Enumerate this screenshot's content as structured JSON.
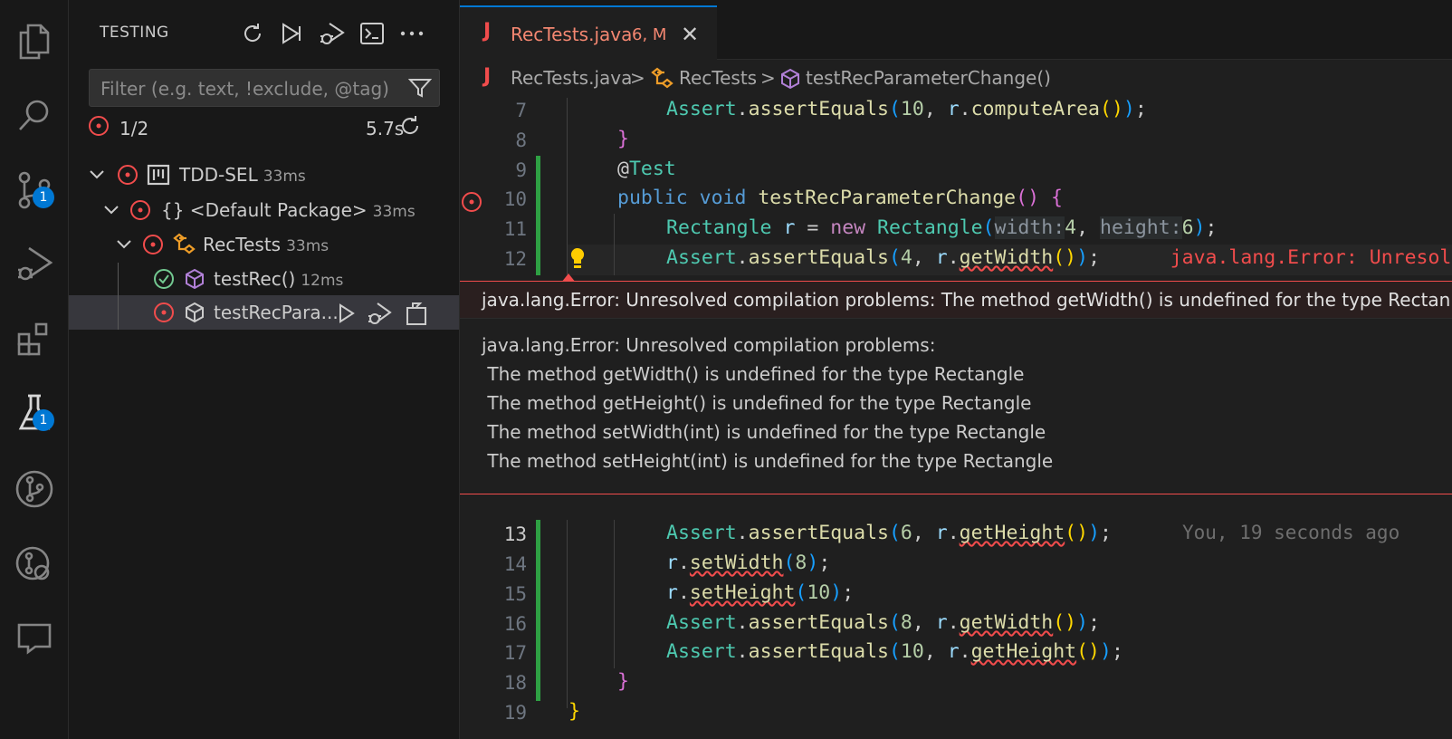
{
  "activity_bar": {
    "items": [
      {
        "name": "explorer-icon",
        "badge": ""
      },
      {
        "name": "search-icon",
        "badge": ""
      },
      {
        "name": "source-control-icon",
        "badge": "1"
      },
      {
        "name": "run-debug-icon",
        "badge": ""
      },
      {
        "name": "extensions-icon",
        "badge": ""
      },
      {
        "name": "testing-icon",
        "badge": "1"
      },
      {
        "name": "git-graph-icon",
        "badge": ""
      },
      {
        "name": "git-lens-icon",
        "badge": ""
      },
      {
        "name": "chat-icon",
        "badge": ""
      }
    ]
  },
  "sidebar": {
    "title": "TESTING",
    "filter_placeholder": "Filter (e.g. text, !exclude, @tag)",
    "summary": {
      "count": "1/2",
      "time": "5.7s"
    },
    "tree": [
      {
        "label": "TDD-SEL",
        "duration": "33ms",
        "status": "failed"
      },
      {
        "label": "{} <Default Package>",
        "duration": "33ms",
        "status": "failed"
      },
      {
        "label": "RecTests",
        "duration": "33ms",
        "status": "failed"
      },
      {
        "label": "testRec()",
        "duration": "12ms",
        "status": "passed"
      },
      {
        "label": "testRecPara...",
        "duration": "",
        "status": "failed"
      }
    ]
  },
  "editor": {
    "tab": {
      "icon": "J",
      "name": "RecTests.java",
      "status": "6, M"
    },
    "breadcrumb": [
      "RecTests.java",
      ">",
      "RecTests",
      ">",
      "testRecParameterChange()"
    ],
    "lines_top": [
      "7",
      "8",
      "9",
      "10",
      "11",
      "12"
    ],
    "lines_bottom": [
      "13",
      "14",
      "15",
      "16",
      "17",
      "18",
      "19"
    ],
    "code": {
      "l7": {
        "a": "Assert",
        "b": ".",
        "c": "assertEquals",
        "d": "(",
        "e": "10",
        "f": ", ",
        "g": "r",
        "h": ".",
        "i": "computeArea",
        "j": "()",
        "k": ")",
        "l": ";"
      },
      "l8": "}",
      "l9": {
        "at": "@",
        "t": "Test"
      },
      "l10": {
        "a": "public",
        "b": " ",
        "c": "void",
        "d": " ",
        "e": "testRecParameterChange",
        "f": "()",
        "g": " {"
      },
      "l11": {
        "a": "Rectangle",
        "b": " ",
        "c": "r",
        "d": " = ",
        "e": "new",
        "f": " ",
        "g": "Rectangle",
        "h": "(",
        "i": "width:",
        "j": "4",
        "k": ", ",
        "l": "height:",
        "m": "6",
        "n": ")",
        "o": ";"
      },
      "l12": {
        "a": "Assert",
        "b": ".",
        "c": "assertEquals",
        "d": "(",
        "e": "4",
        "f": ", ",
        "g": "r",
        "h": ".",
        "i": "getWidth",
        "j": "()",
        "k": ")",
        "l": ";",
        "err": "java.lang.Error: Unresol"
      },
      "l13": {
        "a": "Assert",
        "b": ".",
        "c": "assertEquals",
        "d": "(",
        "e": "6",
        "f": ", ",
        "g": "r",
        "h": ".",
        "i": "getHeight",
        "j": "()",
        "k": ")",
        "l": ";"
      },
      "l14": {
        "a": "r",
        "b": ".",
        "c": "setWidth",
        "d": "(",
        "e": "8",
        "f": ")",
        "g": ";"
      },
      "l15": {
        "a": "r",
        "b": ".",
        "c": "setHeight",
        "d": "(",
        "e": "10",
        "f": ")",
        "g": ";"
      },
      "l16": {
        "a": "Assert",
        "b": ".",
        "c": "assertEquals",
        "d": "(",
        "e": "8",
        "f": ", ",
        "g": "r",
        "h": ".",
        "i": "getWidth",
        "j": "()",
        "k": ")",
        "l": ";"
      },
      "l17": {
        "a": "Assert",
        "b": ".",
        "c": "assertEquals",
        "d": "(",
        "e": "10",
        "f": ", ",
        "g": "r",
        "h": ".",
        "i": "getHeight",
        "j": "()",
        "k": ")",
        "l": ";"
      },
      "l18": "}",
      "l19": "}"
    },
    "blame": "You, 19 seconds ago",
    "peek": {
      "header": "java.lang.Error: Unresolved compilation problems: The method getWidth() is undefined for the type Rectan",
      "lines": [
        "java.lang.Error: Unresolved compilation problems:",
        " The method getWidth() is undefined for the type Rectangle",
        " The method getHeight() is undefined for the type Rectangle",
        " The method setWidth(int) is undefined for the type Rectangle",
        " The method setHeight(int) is undefined for the type Rectangle"
      ]
    }
  },
  "colors": {
    "accent": "#0078d4",
    "error": "#f14c4c",
    "passed": "#73c991",
    "added": "#2ea043"
  }
}
